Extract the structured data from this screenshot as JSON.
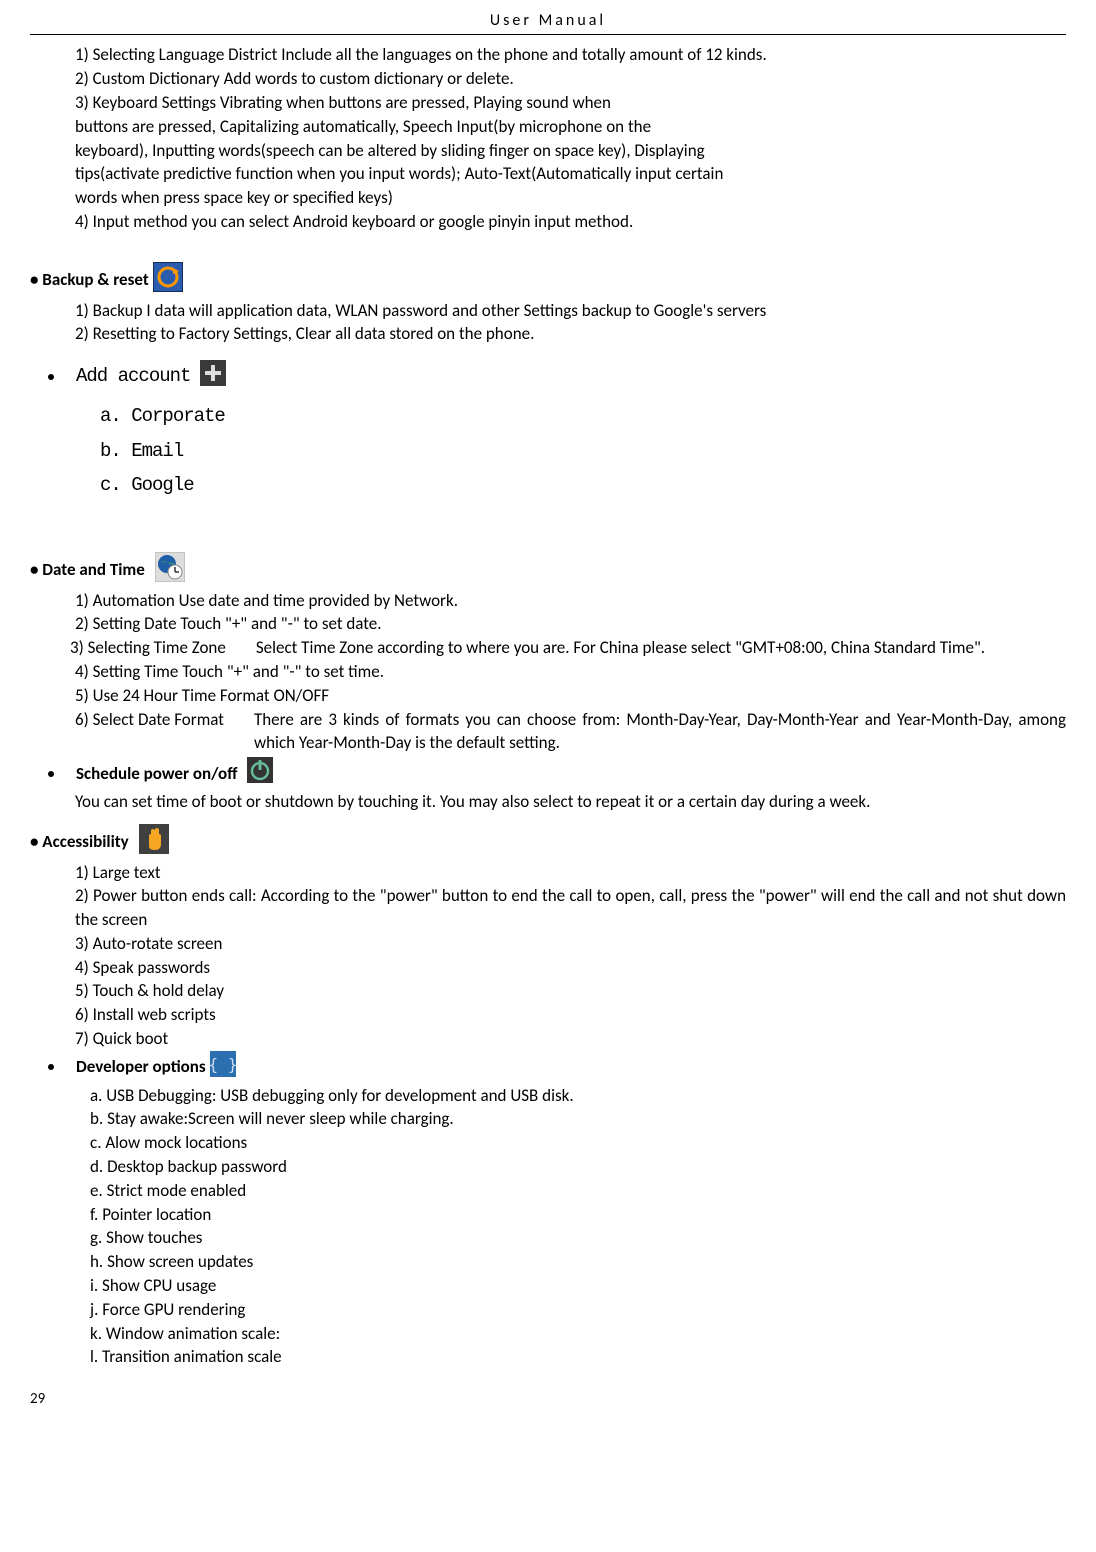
{
  "header": "User    Manual",
  "top_items": [
    "1) Selecting Language District        Include all the languages on the phone and totally amount of 12 kinds.",
    "2) Custom Dictionary           Add words to custom dictionary or delete.",
    "3) Keyboard Settings         Vibrating when buttons are pressed, Playing sound when",
    "buttons are pressed, Capitalizing automatically, Speech Input(by microphone on the",
    "keyboard), Inputting words(speech can be altered by sliding finger on space key), Displaying",
    "tips(activate predictive function when you input words); Auto-Text(Automatically input certain",
    "words when press space key or specified keys)",
    "4) Input method        you can select Android keyboard or google pinyin input method."
  ],
  "backup": {
    "title": "• Backup & reset",
    "items": [
      "1)    Backup I data will application data, WLAN password and other Settings backup to Google's servers",
      "2)    Resetting to Factory Settings, Clear all data stored on the phone."
    ]
  },
  "add_account": {
    "title": "Add account",
    "sub": [
      "a.   Corporate",
      "b.   Email",
      "c.   Google"
    ]
  },
  "datetime": {
    "title": "• Date and Time",
    "items": [
      "1) Automation        Use date and time provided by Network.",
      "2) Setting Date        Touch \"+\" and \"-\" to set date."
    ],
    "item3_label": "3) Selecting  Time  Zone",
    "item3_text": "Select  Time  Zone  according  to  where  you  are.  For  China  please  select  \"GMT+08:00, China Standard Time\".",
    "item4": "4) Setting Time        Touch \"+\" and \"-\" to set time.",
    "item5": "5) Use 24 Hour Time Format        ON/OFF",
    "item6_label": "6)  Select  Date  Format",
    "item6_text": "There  are  3  kinds  of  formats  you  can  choose  from:  Month-Day-Year,  Day-Month-Year and Year-Month-Day, among which Year-Month-Day is the default setting."
  },
  "schedule": {
    "title": "Schedule power on/off",
    "text": "You can  set  time  of  boot  or  shutdown  by  touching  it.  You  may  also  select  to  repeat  it  or  a  certain  day  during  a week."
  },
  "accessibility": {
    "title": "• Accessibility",
    "items": [
      "1)    Large text",
      "2)    Power button ends call: According to the \"power\" button to end the call to open, call, press the \"power\" will end the call and not shut down the screen",
      "3)    Auto-rotate screen",
      "4)    Speak passwords",
      "5)    Touch & hold delay",
      "6)    Install web scripts",
      "7)    Quick boot"
    ]
  },
  "developer": {
    "title": "Developer    options",
    "items": [
      "a.    USB Debugging: USB debugging only for development and USB disk.",
      "b.    Stay awake:Screen will never sleep while charging.",
      "c.    Alow mock locations",
      "d.    Desktop backup password",
      "e.    Strict mode enabled",
      "f.     Pointer location",
      "g.    Show touches",
      "h.    Show screen updates",
      "i.     Show   CPU usage",
      "j.     Force GPU rendering",
      "k.    Window animation scale:",
      "l.     Transition animation scale"
    ]
  },
  "page_num": "29"
}
